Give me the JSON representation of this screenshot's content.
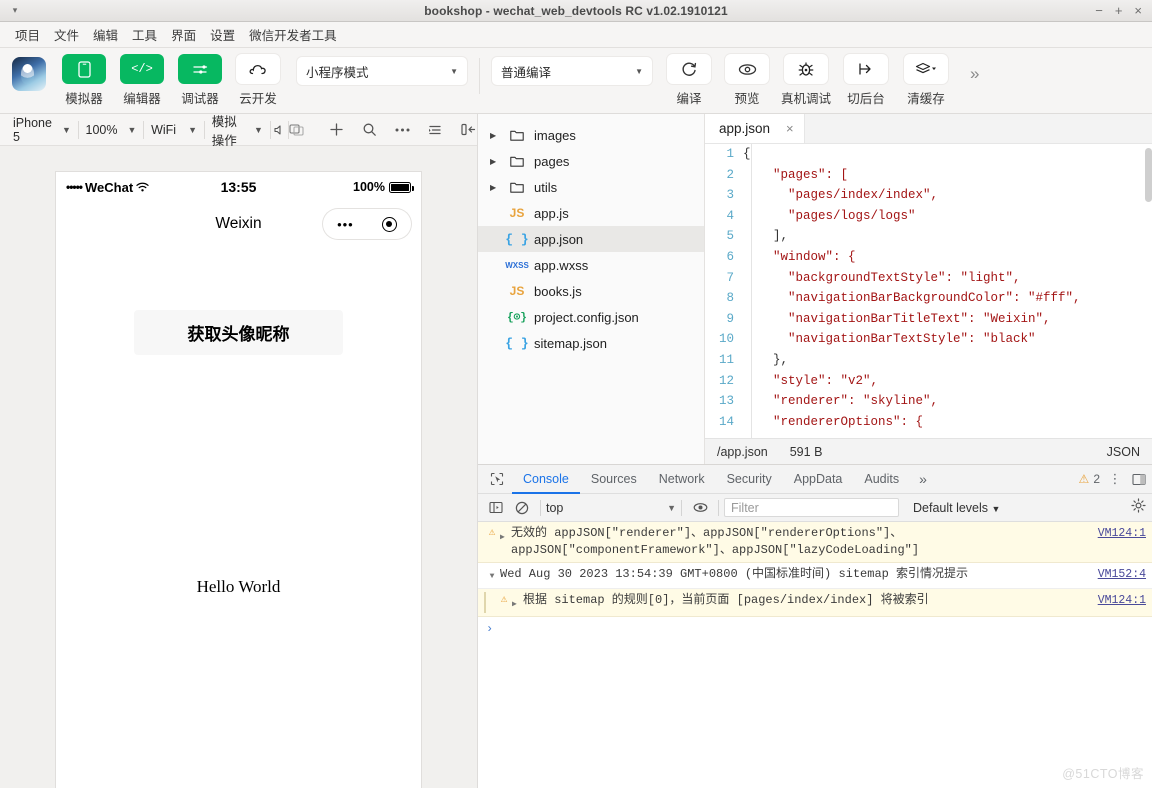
{
  "window": {
    "title": "bookshop - wechat_web_devtools RC v1.02.1910121",
    "minimize": "−",
    "maximize": "+",
    "close": "×",
    "menu_caret": "▾"
  },
  "menubar": {
    "items": [
      {
        "label": "项目",
        "name": "menu-project"
      },
      {
        "label": "文件",
        "name": "menu-file"
      },
      {
        "label": "编辑",
        "name": "menu-edit"
      },
      {
        "label": "工具",
        "name": "menu-tools"
      },
      {
        "label": "界面",
        "name": "menu-view"
      },
      {
        "label": "设置",
        "name": "menu-settings"
      },
      {
        "label": "微信开发者工具",
        "name": "menu-wechat-devtools"
      }
    ]
  },
  "toolbar": {
    "simulator_label": "模拟器",
    "editor_label": "编辑器",
    "debugger_label": "调试器",
    "cloud_label": "云开发",
    "mode_select": "小程序模式",
    "compile_select": "普通编译",
    "compile_label": "编译",
    "preview_label": "预览",
    "realdevice_label": "真机调试",
    "background_label": "切后台",
    "clearcache_label": "清缓存",
    "overflow": "»"
  },
  "simulator_bar": {
    "device": "iPhone 5",
    "zoom": "100%",
    "network": "WiFi",
    "mock": "模拟操作",
    "icons": [
      "volume-icon",
      "rotate-icon"
    ]
  },
  "simulator_toolbar_right": {
    "icons": [
      "add-icon",
      "search-icon",
      "more-icon",
      "outline-icon",
      "collapse-icon"
    ]
  },
  "phone": {
    "carrier": "WeChat",
    "signal_dots": "•••••",
    "time": "13:55",
    "battery_pct": "100%",
    "nav_title": "Weixin",
    "button_label": "获取头像昵称",
    "hello": "Hello World"
  },
  "filetree": {
    "items": [
      {
        "label": "images",
        "type": "folder",
        "icon": "folder-icon",
        "expandable": true,
        "selected": false
      },
      {
        "label": "pages",
        "type": "folder",
        "icon": "folder-icon",
        "expandable": true,
        "selected": false
      },
      {
        "label": "utils",
        "type": "folder",
        "icon": "folder-icon",
        "expandable": true,
        "selected": false
      },
      {
        "label": "app.js",
        "type": "js",
        "icon": "js-file-icon",
        "expandable": false,
        "selected": false
      },
      {
        "label": "app.json",
        "type": "json",
        "icon": "json-file-icon",
        "expandable": false,
        "selected": true
      },
      {
        "label": "app.wxss",
        "type": "wxss",
        "icon": "wxss-file-icon",
        "expandable": false,
        "selected": false
      },
      {
        "label": "books.js",
        "type": "js",
        "icon": "js-file-icon",
        "expandable": false,
        "selected": false
      },
      {
        "label": "project.config.json",
        "type": "config",
        "icon": "config-file-icon",
        "expandable": false,
        "selected": false
      },
      {
        "label": "sitemap.json",
        "type": "json",
        "icon": "json-file-icon",
        "expandable": false,
        "selected": false
      }
    ]
  },
  "editor": {
    "tab_label": "app.json",
    "tab_close": "×",
    "lines": [
      {
        "n": "1",
        "text": "{"
      },
      {
        "n": "2",
        "text": "    \"pages\": ["
      },
      {
        "n": "3",
        "text": "      \"pages/index/index\","
      },
      {
        "n": "4",
        "text": "      \"pages/logs/logs\""
      },
      {
        "n": "5",
        "text": "    ],"
      },
      {
        "n": "6",
        "text": "    \"window\": {"
      },
      {
        "n": "7",
        "text": "      \"backgroundTextStyle\": \"light\","
      },
      {
        "n": "8",
        "text": "      \"navigationBarBackgroundColor\": \"#fff\","
      },
      {
        "n": "9",
        "text": "      \"navigationBarTitleText\": \"Weixin\","
      },
      {
        "n": "10",
        "text": "      \"navigationBarTextStyle\": \"black\""
      },
      {
        "n": "11",
        "text": "    },"
      },
      {
        "n": "12",
        "text": "    \"style\": \"v2\","
      },
      {
        "n": "13",
        "text": "    \"renderer\": \"skyline\","
      },
      {
        "n": "14",
        "text": "    \"rendererOptions\": {"
      }
    ],
    "status_path": "/app.json",
    "status_size": "591 B",
    "status_lang": "JSON"
  },
  "devtools": {
    "tabs": [
      {
        "label": "Console",
        "active": true
      },
      {
        "label": "Sources",
        "active": false
      },
      {
        "label": "Network",
        "active": false
      },
      {
        "label": "Security",
        "active": false
      },
      {
        "label": "AppData",
        "active": false
      },
      {
        "label": "Audits",
        "active": false
      }
    ],
    "more": "»",
    "warning_count": "2",
    "filters": {
      "context": "top",
      "filter_placeholder": "Filter",
      "levels": "Default levels",
      "caret": "▾"
    },
    "messages": [
      {
        "kind": "warning",
        "text": "无效的 appJSON[\"renderer\"]、appJSON[\"rendererOptions\"]、appJSON[\"componentFramework\"]、appJSON[\"lazyCodeLoading\"]",
        "source": "VM124:1"
      },
      {
        "kind": "info",
        "text": "Wed Aug 30 2023 13:54:39 GMT+0800 (中国标准时间) sitemap 索引情况提示",
        "source": "VM152:4"
      },
      {
        "kind": "warning-sub",
        "text": "根据 sitemap 的规则[0]，当前页面 [pages/index/index] 将被索引",
        "source": "VM124:1"
      }
    ],
    "prompt": "›"
  },
  "watermark": "@51CTO博客",
  "colors": {
    "accent_green": "#07b861",
    "tab_active_blue": "#1a73e8",
    "warning_yellow": "#e8a33d",
    "warning_bg": "#fffbe6",
    "string_red": "#a31515",
    "linenum_blue": "#5aa9c8"
  }
}
